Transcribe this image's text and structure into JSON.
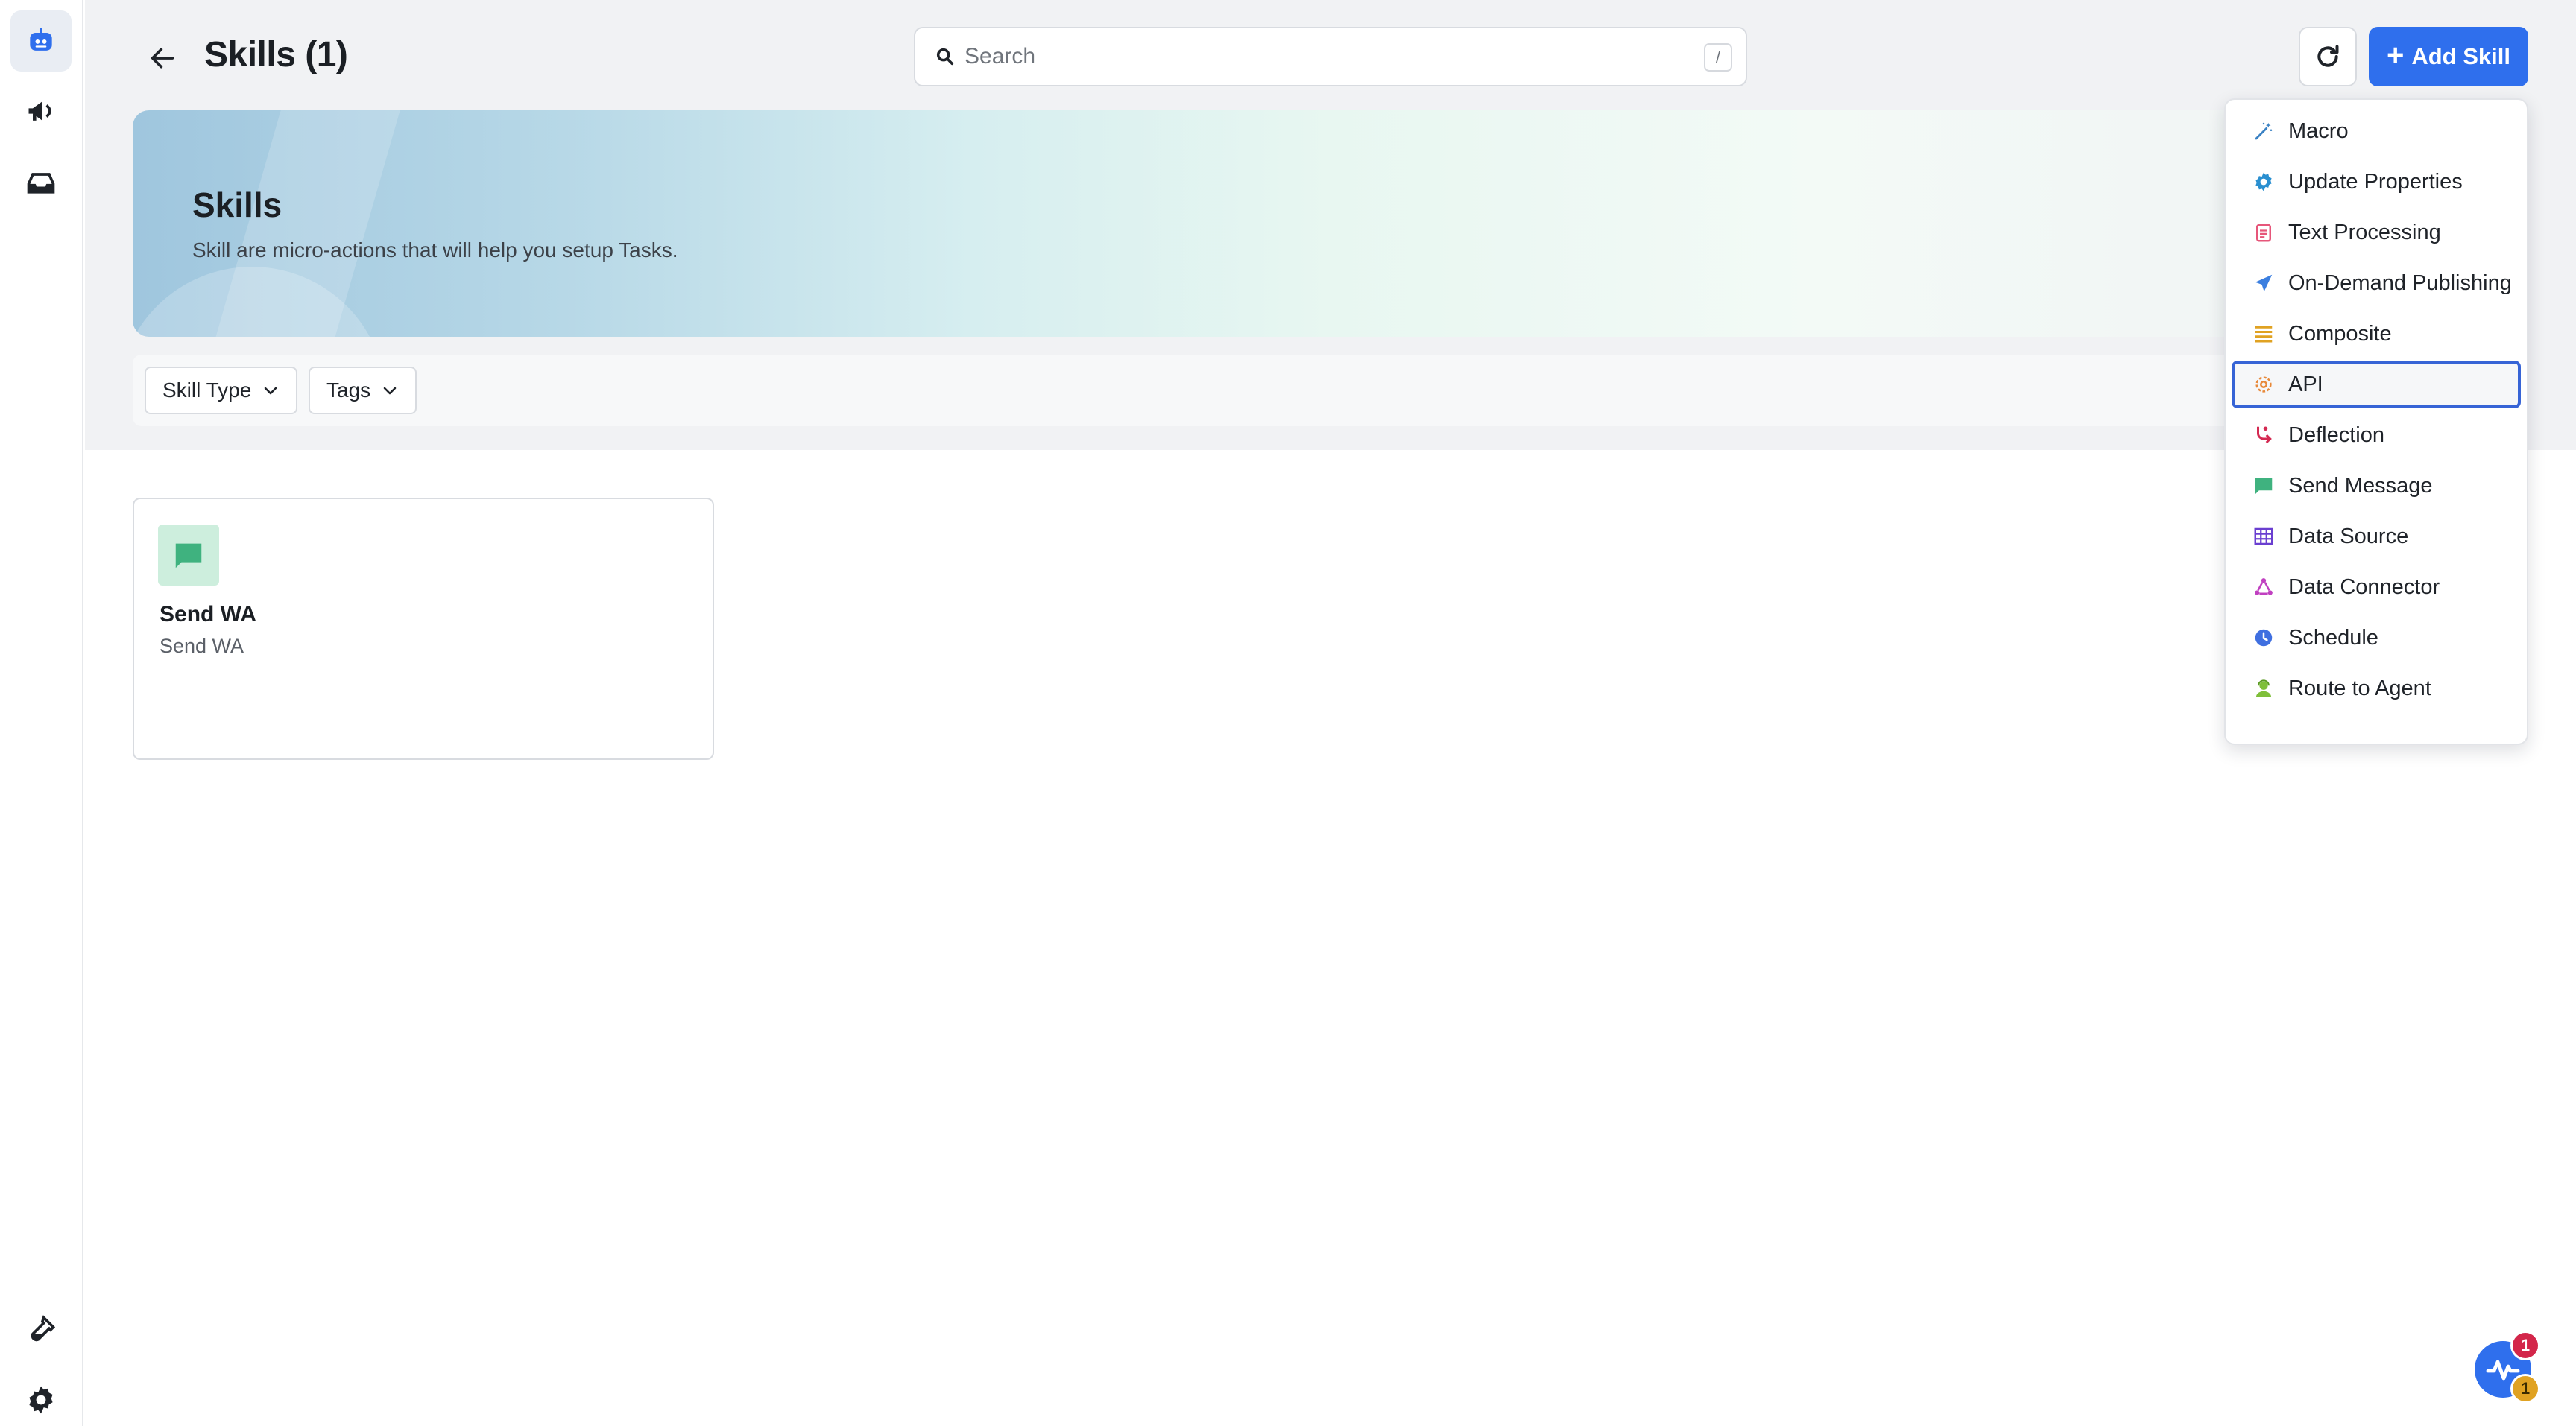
{
  "colors": {
    "accent": "#2f6fed",
    "page_bg_top": "#f1f2f4",
    "selected_outline": "#3764d6",
    "badge_red": "#d3264a",
    "badge_yellow": "#e0a222"
  },
  "rail": {
    "items": [
      {
        "icon": "bot-icon",
        "active": true
      },
      {
        "icon": "megaphone-icon"
      },
      {
        "icon": "inbox-icon"
      }
    ],
    "bottom": [
      {
        "icon": "test-tube-icon"
      },
      {
        "icon": "gear-icon"
      }
    ]
  },
  "header": {
    "title": "Skills (1)",
    "search_placeholder": "Search",
    "search_shortcut": "/",
    "add_button_label": "Add Skill"
  },
  "banner": {
    "title": "Skills",
    "subtitle": "Skill are micro-actions that will help you setup Tasks."
  },
  "filters": [
    {
      "label": "Skill Type"
    },
    {
      "label": "Tags"
    }
  ],
  "skills": [
    {
      "title": "Send WA",
      "subtitle": "Send WA",
      "icon": "chat-bubble-icon"
    }
  ],
  "add_menu": {
    "items": [
      {
        "label": "Macro",
        "icon": "magic-wand-icon",
        "color": "#3b82c4"
      },
      {
        "label": "Update Properties",
        "icon": "gear-icon",
        "color": "#2a8fd0"
      },
      {
        "label": "Text Processing",
        "icon": "clipboard-icon",
        "color": "#e6567a"
      },
      {
        "label": "On-Demand Publishing",
        "icon": "paper-plane-icon",
        "color": "#3b7fe0"
      },
      {
        "label": "Composite",
        "icon": "stack-lines-icon",
        "color": "#e0a222"
      },
      {
        "label": "API",
        "icon": "api-icon",
        "color": "#e8893a",
        "selected": true
      },
      {
        "label": "Deflection",
        "icon": "deflection-icon",
        "color": "#d42a52"
      },
      {
        "label": "Send Message",
        "icon": "message-icon",
        "color": "#3fb27f"
      },
      {
        "label": "Data Source",
        "icon": "grid-table-icon",
        "color": "#6a3fd0"
      },
      {
        "label": "Data Connector",
        "icon": "connector-icon",
        "color": "#c040c0"
      },
      {
        "label": "Schedule",
        "icon": "clock-icon",
        "color": "#3f6fe0"
      },
      {
        "label": "Route to Agent",
        "icon": "agent-icon",
        "color": "#7fbf3a"
      }
    ]
  },
  "help_widget": {
    "badge_top": "1",
    "badge_bottom": "1"
  }
}
